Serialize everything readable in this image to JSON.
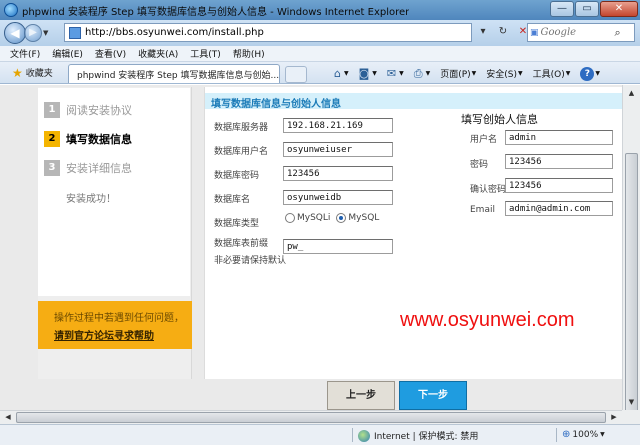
{
  "window": {
    "title": "phpwind 安装程序 Step 填写数据库信息与创始人信息 - Windows Internet Explorer"
  },
  "address_bar": {
    "url": "http://bbs.osyunwei.com/install.php",
    "search_placeholder": "Google"
  },
  "menu": [
    "文件(F)",
    "编辑(E)",
    "查看(V)",
    "收藏夹(A)",
    "工具(T)",
    "帮助(H)"
  ],
  "favorites_label": "收藏夹",
  "tab": {
    "title": "phpwind 安装程序 Step 填写数据库信息与创始..."
  },
  "command_bar": {
    "page": "页面(P)",
    "safety": "安全(S)",
    "tools": "工具(O)"
  },
  "steps": [
    {
      "num": "1",
      "label": "阅读安装协议",
      "state": "inactive"
    },
    {
      "num": "2",
      "label": "填写数据信息",
      "state": "active"
    },
    {
      "num": "3",
      "label": "安装详细信息",
      "state": "inactive"
    },
    {
      "num": "",
      "label": "安装成功！",
      "state": "done"
    }
  ],
  "help": {
    "line1": "操作过程中若遇到任何问题，",
    "line2": "请到官方论坛寻求帮助"
  },
  "db_section": {
    "title": "填写数据库信息与创始人信息",
    "server_label": "数据库服务器",
    "server_value": "192.168.21.169",
    "user_label": "数据库用户名",
    "user_value": "osyunweiuser",
    "password_label": "数据库密码",
    "password_value": "123456",
    "name_label": "数据库名",
    "name_value": "osyunweidb",
    "type_label": "数据库类型",
    "type_options": [
      "MySQLi",
      "MySQL"
    ],
    "type_selected": "MySQL",
    "prefix_label_1": "数据库表前缀",
    "prefix_label_2": "非必要请保持默认",
    "prefix_value": "pw_"
  },
  "admin_section": {
    "title": "填写创始人信息",
    "username_label": "用户名",
    "username_value": "admin",
    "password_label": "密码",
    "password_value": "123456",
    "confirm_label": "确认密码",
    "confirm_value": "123456",
    "email_label": "Email",
    "email_value": "admin@admin.com"
  },
  "watermark": "www.osyunwei.com",
  "buttons": {
    "prev": "上一步",
    "next": "下一步"
  },
  "status": {
    "zone": "Internet | 保护模式: 禁用",
    "zoom": "100%"
  },
  "colors": {
    "step_active": "#f4b400",
    "help_box": "#f6ad13",
    "section_header_bg": "#d5f0fb",
    "section_header_text": "#1b7bb8",
    "next_button": "#1f9ce0",
    "watermark": "#ef1010"
  }
}
